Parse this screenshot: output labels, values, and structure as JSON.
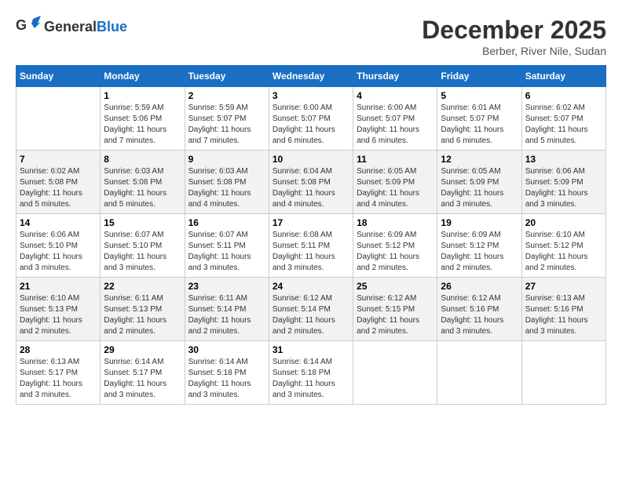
{
  "header": {
    "logo_general": "General",
    "logo_blue": "Blue",
    "month_title": "December 2025",
    "location": "Berber, River Nile, Sudan"
  },
  "weekdays": [
    "Sunday",
    "Monday",
    "Tuesday",
    "Wednesday",
    "Thursday",
    "Friday",
    "Saturday"
  ],
  "weeks": [
    [
      {
        "day": "",
        "sunrise": "",
        "sunset": "",
        "daylight": ""
      },
      {
        "day": "1",
        "sunrise": "Sunrise: 5:59 AM",
        "sunset": "Sunset: 5:06 PM",
        "daylight": "Daylight: 11 hours and 7 minutes."
      },
      {
        "day": "2",
        "sunrise": "Sunrise: 5:59 AM",
        "sunset": "Sunset: 5:07 PM",
        "daylight": "Daylight: 11 hours and 7 minutes."
      },
      {
        "day": "3",
        "sunrise": "Sunrise: 6:00 AM",
        "sunset": "Sunset: 5:07 PM",
        "daylight": "Daylight: 11 hours and 6 minutes."
      },
      {
        "day": "4",
        "sunrise": "Sunrise: 6:00 AM",
        "sunset": "Sunset: 5:07 PM",
        "daylight": "Daylight: 11 hours and 6 minutes."
      },
      {
        "day": "5",
        "sunrise": "Sunrise: 6:01 AM",
        "sunset": "Sunset: 5:07 PM",
        "daylight": "Daylight: 11 hours and 6 minutes."
      },
      {
        "day": "6",
        "sunrise": "Sunrise: 6:02 AM",
        "sunset": "Sunset: 5:07 PM",
        "daylight": "Daylight: 11 hours and 5 minutes."
      }
    ],
    [
      {
        "day": "7",
        "sunrise": "Sunrise: 6:02 AM",
        "sunset": "Sunset: 5:08 PM",
        "daylight": "Daylight: 11 hours and 5 minutes."
      },
      {
        "day": "8",
        "sunrise": "Sunrise: 6:03 AM",
        "sunset": "Sunset: 5:08 PM",
        "daylight": "Daylight: 11 hours and 5 minutes."
      },
      {
        "day": "9",
        "sunrise": "Sunrise: 6:03 AM",
        "sunset": "Sunset: 5:08 PM",
        "daylight": "Daylight: 11 hours and 4 minutes."
      },
      {
        "day": "10",
        "sunrise": "Sunrise: 6:04 AM",
        "sunset": "Sunset: 5:08 PM",
        "daylight": "Daylight: 11 hours and 4 minutes."
      },
      {
        "day": "11",
        "sunrise": "Sunrise: 6:05 AM",
        "sunset": "Sunset: 5:09 PM",
        "daylight": "Daylight: 11 hours and 4 minutes."
      },
      {
        "day": "12",
        "sunrise": "Sunrise: 6:05 AM",
        "sunset": "Sunset: 5:09 PM",
        "daylight": "Daylight: 11 hours and 3 minutes."
      },
      {
        "day": "13",
        "sunrise": "Sunrise: 6:06 AM",
        "sunset": "Sunset: 5:09 PM",
        "daylight": "Daylight: 11 hours and 3 minutes."
      }
    ],
    [
      {
        "day": "14",
        "sunrise": "Sunrise: 6:06 AM",
        "sunset": "Sunset: 5:10 PM",
        "daylight": "Daylight: 11 hours and 3 minutes."
      },
      {
        "day": "15",
        "sunrise": "Sunrise: 6:07 AM",
        "sunset": "Sunset: 5:10 PM",
        "daylight": "Daylight: 11 hours and 3 minutes."
      },
      {
        "day": "16",
        "sunrise": "Sunrise: 6:07 AM",
        "sunset": "Sunset: 5:11 PM",
        "daylight": "Daylight: 11 hours and 3 minutes."
      },
      {
        "day": "17",
        "sunrise": "Sunrise: 6:08 AM",
        "sunset": "Sunset: 5:11 PM",
        "daylight": "Daylight: 11 hours and 3 minutes."
      },
      {
        "day": "18",
        "sunrise": "Sunrise: 6:09 AM",
        "sunset": "Sunset: 5:12 PM",
        "daylight": "Daylight: 11 hours and 2 minutes."
      },
      {
        "day": "19",
        "sunrise": "Sunrise: 6:09 AM",
        "sunset": "Sunset: 5:12 PM",
        "daylight": "Daylight: 11 hours and 2 minutes."
      },
      {
        "day": "20",
        "sunrise": "Sunrise: 6:10 AM",
        "sunset": "Sunset: 5:12 PM",
        "daylight": "Daylight: 11 hours and 2 minutes."
      }
    ],
    [
      {
        "day": "21",
        "sunrise": "Sunrise: 6:10 AM",
        "sunset": "Sunset: 5:13 PM",
        "daylight": "Daylight: 11 hours and 2 minutes."
      },
      {
        "day": "22",
        "sunrise": "Sunrise: 6:11 AM",
        "sunset": "Sunset: 5:13 PM",
        "daylight": "Daylight: 11 hours and 2 minutes."
      },
      {
        "day": "23",
        "sunrise": "Sunrise: 6:11 AM",
        "sunset": "Sunset: 5:14 PM",
        "daylight": "Daylight: 11 hours and 2 minutes."
      },
      {
        "day": "24",
        "sunrise": "Sunrise: 6:12 AM",
        "sunset": "Sunset: 5:14 PM",
        "daylight": "Daylight: 11 hours and 2 minutes."
      },
      {
        "day": "25",
        "sunrise": "Sunrise: 6:12 AM",
        "sunset": "Sunset: 5:15 PM",
        "daylight": "Daylight: 11 hours and 2 minutes."
      },
      {
        "day": "26",
        "sunrise": "Sunrise: 6:12 AM",
        "sunset": "Sunset: 5:16 PM",
        "daylight": "Daylight: 11 hours and 3 minutes."
      },
      {
        "day": "27",
        "sunrise": "Sunrise: 6:13 AM",
        "sunset": "Sunset: 5:16 PM",
        "daylight": "Daylight: 11 hours and 3 minutes."
      }
    ],
    [
      {
        "day": "28",
        "sunrise": "Sunrise: 6:13 AM",
        "sunset": "Sunset: 5:17 PM",
        "daylight": "Daylight: 11 hours and 3 minutes."
      },
      {
        "day": "29",
        "sunrise": "Sunrise: 6:14 AM",
        "sunset": "Sunset: 5:17 PM",
        "daylight": "Daylight: 11 hours and 3 minutes."
      },
      {
        "day": "30",
        "sunrise": "Sunrise: 6:14 AM",
        "sunset": "Sunset: 5:18 PM",
        "daylight": "Daylight: 11 hours and 3 minutes."
      },
      {
        "day": "31",
        "sunrise": "Sunrise: 6:14 AM",
        "sunset": "Sunset: 5:18 PM",
        "daylight": "Daylight: 11 hours and 3 minutes."
      },
      {
        "day": "",
        "sunrise": "",
        "sunset": "",
        "daylight": ""
      },
      {
        "day": "",
        "sunrise": "",
        "sunset": "",
        "daylight": ""
      },
      {
        "day": "",
        "sunrise": "",
        "sunset": "",
        "daylight": ""
      }
    ]
  ]
}
